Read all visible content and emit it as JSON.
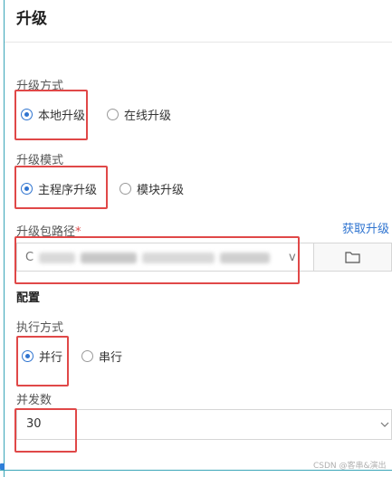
{
  "header": {
    "title": "升级"
  },
  "upgrade_method": {
    "label": "升级方式",
    "options": [
      {
        "label": "本地升级",
        "checked": true
      },
      {
        "label": "在线升级",
        "checked": false
      }
    ]
  },
  "upgrade_mode": {
    "label": "升级模式",
    "options": [
      {
        "label": "主程序升级",
        "checked": true
      },
      {
        "label": "模块升级",
        "checked": false
      }
    ]
  },
  "package_path": {
    "label": "升级包路径",
    "required_mark": "*",
    "fetch_link": "获取升级",
    "value_start": "C",
    "value_end": "v"
  },
  "config": {
    "section_title": "配置",
    "exec_label": "执行方式",
    "exec_options": [
      {
        "label": "并行",
        "checked": true
      },
      {
        "label": "串行",
        "checked": false
      }
    ],
    "concurrency_label": "并发数",
    "concurrency_value": "30"
  },
  "watermark": "CSDN @客串&演出",
  "colors": {
    "accent": "#2f74d0",
    "highlight": "#e04848",
    "frame": "#3aa5b8"
  }
}
